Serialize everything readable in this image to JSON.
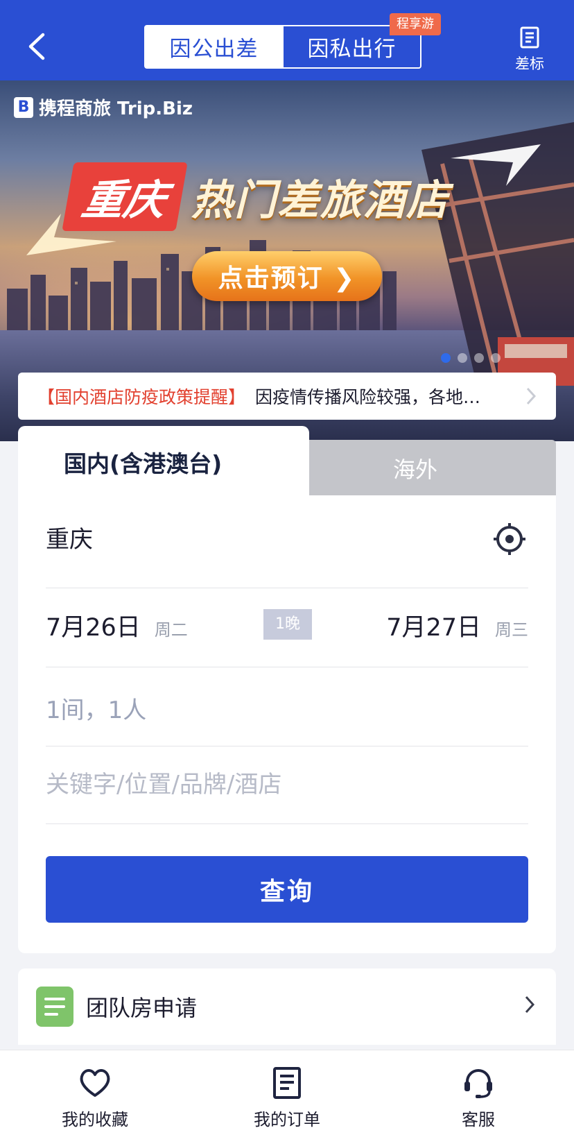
{
  "header": {
    "back_icon": "chevron-left-icon",
    "tabs": [
      {
        "label": "因公出差",
        "active": true
      },
      {
        "label": "因私出行",
        "active": false
      }
    ],
    "promo_badge": "程享游",
    "standard_label": "差标",
    "standard_icon": "document-icon",
    "colors": {
      "primary": "#2a4fd3",
      "badge": "#ef6a4a"
    }
  },
  "banner": {
    "brand": "携程商旅 Trip.Biz",
    "city_tag": "重庆",
    "headline": "热门差旅酒店",
    "cta": "点击预订 ❯",
    "dots": [
      true,
      false,
      false,
      false
    ]
  },
  "notice": {
    "tag": "【国内酒店防疫政策提醒】",
    "message": "因疫情传播风险较强，各地…",
    "chevron_icon": "chevron-right-icon"
  },
  "search": {
    "tabs": [
      {
        "label": "国内(含港澳台)",
        "active": true
      },
      {
        "label": "海外",
        "active": false
      }
    ],
    "city": "重庆",
    "locate_icon": "location-target-icon",
    "checkin": {
      "date": "7月26日",
      "weekday": "周二"
    },
    "nights": "1晚",
    "checkout": {
      "date": "7月27日",
      "weekday": "周三"
    },
    "rooms_guests": "1间，1人",
    "keyword_placeholder": "关键字/位置/品牌/酒店",
    "query_label": "查询"
  },
  "group_room": {
    "label": "团队房申请",
    "icon": "group-form-icon",
    "icon_color": "#7fc46a"
  },
  "bottom_nav": [
    {
      "label": "我的收藏",
      "icon": "heart-icon"
    },
    {
      "label": "我的订单",
      "icon": "order-icon"
    },
    {
      "label": "客服",
      "icon": "headset-icon"
    }
  ]
}
